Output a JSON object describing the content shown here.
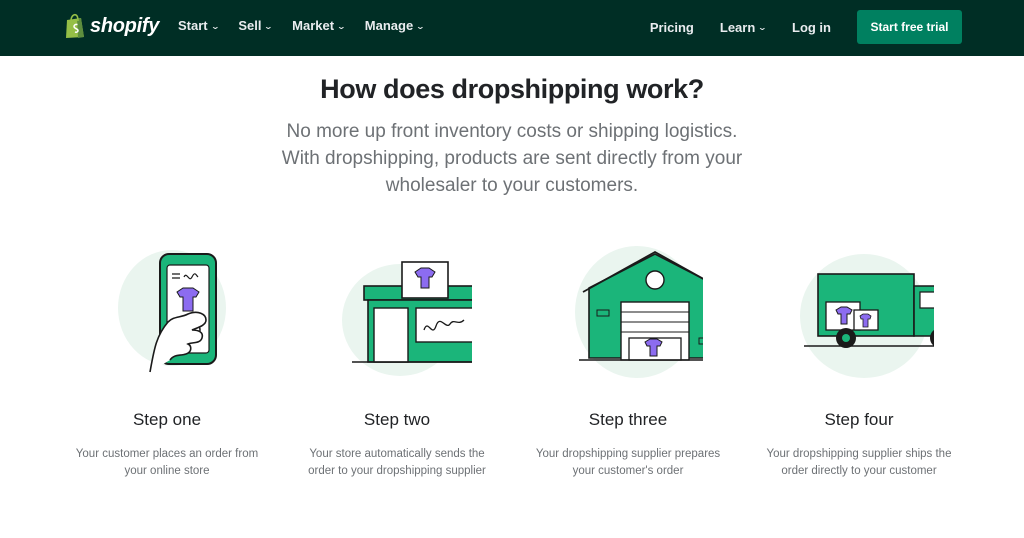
{
  "nav": {
    "logo_text": "shopify",
    "left_items": [
      {
        "label": "Start"
      },
      {
        "label": "Sell"
      },
      {
        "label": "Market"
      },
      {
        "label": "Manage"
      }
    ],
    "pricing": "Pricing",
    "learn": "Learn",
    "login": "Log in",
    "cta": "Start free trial"
  },
  "main": {
    "heading": "How does dropshipping work?",
    "sub_lines": [
      "No more up front inventory costs or shipping logistics.",
      "With dropshipping, products are sent directly from your",
      "wholesaler to your customers."
    ]
  },
  "steps": [
    {
      "title": "Step one",
      "desc": [
        "Your customer places an order from",
        "your online store"
      ],
      "icon": "phone-order-icon"
    },
    {
      "title": "Step two",
      "desc": [
        "Your store automatically sends the",
        "order to your dropshipping supplier"
      ],
      "icon": "storefront-icon"
    },
    {
      "title": "Step three",
      "desc": [
        "Your dropshipping supplier prepares",
        "your customer's order"
      ],
      "icon": "warehouse-icon"
    },
    {
      "title": "Step four",
      "desc": [
        "Your dropshipping supplier ships the",
        "order directly to your customer"
      ],
      "icon": "delivery-truck-icon"
    }
  ],
  "colors": {
    "nav_bg": "#002e25",
    "brand_green": "#008060",
    "illustration_green": "#1bb57a",
    "shirt_purple": "#8c6cf0"
  }
}
